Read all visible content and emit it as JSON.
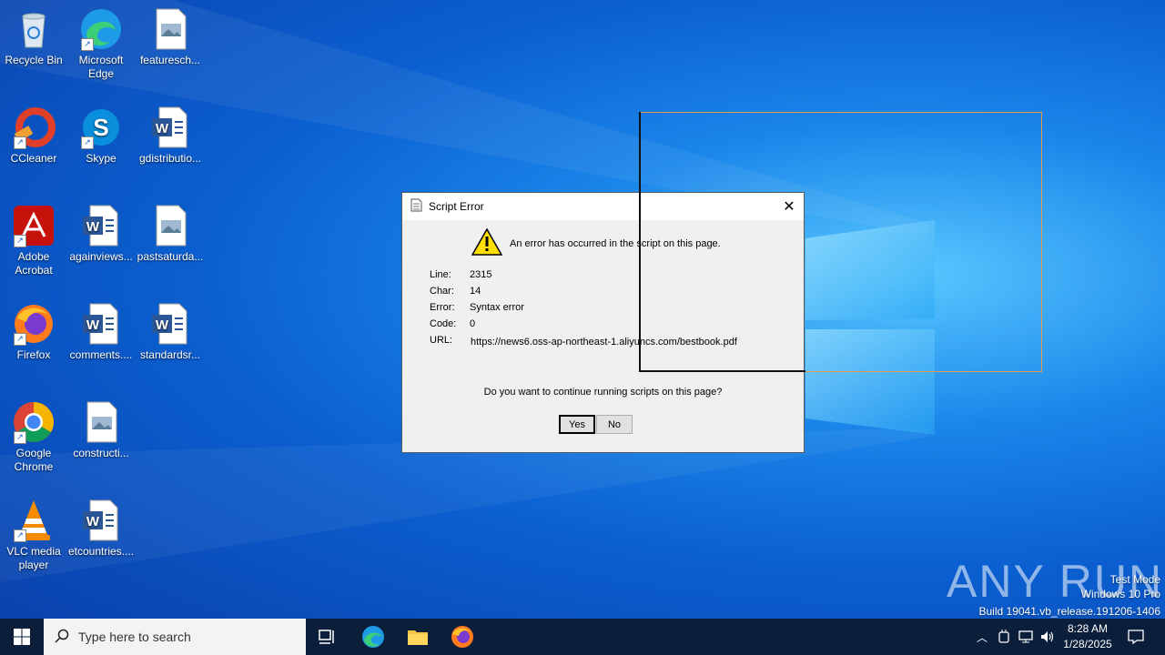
{
  "desktop": {
    "icons": [
      {
        "label": "Recycle Bin",
        "icon": "recycle-bin-icon"
      },
      {
        "label": "Microsoft Edge",
        "icon": "edge-icon"
      },
      {
        "label": "featuresch...",
        "icon": "image-file-icon"
      },
      {
        "label": "CCleaner",
        "icon": "ccleaner-icon"
      },
      {
        "label": "Skype",
        "icon": "skype-icon"
      },
      {
        "label": "gdistributio...",
        "icon": "word-doc-icon"
      },
      {
        "label": "Adobe Acrobat",
        "icon": "acrobat-icon"
      },
      {
        "label": "againviews...",
        "icon": "word-doc-icon"
      },
      {
        "label": "pastsaturda...",
        "icon": "image-file-icon"
      },
      {
        "label": "Firefox",
        "icon": "firefox-icon"
      },
      {
        "label": "comments....",
        "icon": "word-doc-icon"
      },
      {
        "label": "standardsr...",
        "icon": "word-doc-icon"
      },
      {
        "label": "Google Chrome",
        "icon": "chrome-icon"
      },
      {
        "label": "constructi...",
        "icon": "image-file-icon"
      },
      {
        "label": "VLC media player",
        "icon": "vlc-icon"
      },
      {
        "label": "etcountries....",
        "icon": "word-doc-icon"
      }
    ]
  },
  "dialog": {
    "title": "Script Error",
    "message": "An error has occurred in the script on this page.",
    "fields": [
      {
        "key": "Line:",
        "value": "2315"
      },
      {
        "key": "Char:",
        "value": "14"
      },
      {
        "key": "Error:",
        "value": "Syntax error"
      },
      {
        "key": "Code:",
        "value": "0"
      },
      {
        "key": "URL:",
        "value": "https://news6.oss-ap-northeast-1.aliyuncs.com/bestbook.pdf"
      }
    ],
    "question": "Do you want to continue running scripts on this page?",
    "yes_label": "Yes",
    "no_label": "No"
  },
  "watermark": {
    "brand": "ANY RUN",
    "line1": "Test Mode",
    "line2": "Windows 10 Pro",
    "line3": "Build 19041.vb_release.191206-1406"
  },
  "taskbar": {
    "search_placeholder": "Type here to search",
    "time": "8:28 AM",
    "date": "1/28/2025"
  },
  "colors": {
    "accent_orange": "#e89a4b",
    "taskbar": "#0b1f3b"
  }
}
